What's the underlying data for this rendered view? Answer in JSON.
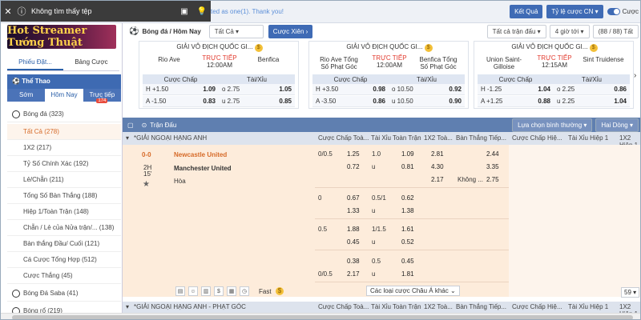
{
  "toast": {
    "title": "Không tìm thấy tệp"
  },
  "top": {
    "thanks": "ted as one(1). Thank you!",
    "ket_qua": "Kết Quả",
    "odds_type": "Tỷ lệ cược CN",
    "toggle_label": "Cược"
  },
  "sidebar": {
    "banner": "Hot Streamer Tướng Thuật",
    "tab_bet": "Phiếu Đặt...",
    "tab_table": "Bảng Cược",
    "sports_title": "Thể Thao",
    "tabs": [
      "Sớm",
      "Hôm Nay",
      "Trực tiếp"
    ],
    "live_badge": "174",
    "items": [
      {
        "label": "Bóng đá (323)",
        "sport": true
      },
      {
        "label": "Tất Cả (278)",
        "selected": true
      },
      {
        "label": "1X2 (217)"
      },
      {
        "label": "Tỷ Số Chính Xác (192)"
      },
      {
        "label": "Lẻ/Chẵn (211)"
      },
      {
        "label": "Tổng Số Bàn Thắng (188)"
      },
      {
        "label": "Hiệp 1/Toàn Trận (148)"
      },
      {
        "label": "Chẵn / Lẻ của Nửa trận/...   (138)"
      },
      {
        "label": "Bàn thắng Đầu/ Cuối (121)"
      },
      {
        "label": "Cá Cược Tổng Hợp (512)"
      },
      {
        "label": "Cược Thắng (45)"
      },
      {
        "label": "Bóng Đá Saba (41)",
        "sport": true
      },
      {
        "label": "Bóng rổ (219)",
        "sport": true
      }
    ]
  },
  "header": {
    "breadcrumb": "Bóng đá / Hôm Nay",
    "filter": "Tất Cả",
    "xien": "Cược Xiên",
    "all_leagues": "Tất cả trận đấu",
    "hours": "4 giờ tới",
    "count": "(88 / 88) Tất"
  },
  "cards": [
    {
      "league": "GIẢI VÔ ĐỊCH QUỐC GI...",
      "home": "Rio Ave",
      "away": "Benfica",
      "live": "TRỰC TIẾP",
      "time": "12:00AM",
      "h_hcap": "+1.50",
      "h_odds": "1.09",
      "h_ou": "o 2.75",
      "h_ou_odds": "1.05",
      "a_hcap": "-1.50",
      "a_odds": "0.83",
      "a_ou": "u 2.75",
      "a_ou_odds": "0.85"
    },
    {
      "league": "GIẢI VÔ ĐỊCH QUỐC GI...",
      "home": "Rio Ave Tổng Số Phạt Góc",
      "away": "Benfica Tổng Số Phạt Góc",
      "live": "TRỰC TIẾP",
      "time": "12:00AM",
      "h_hcap": "+3.50",
      "h_odds": "0.98",
      "h_ou": "o 10.50",
      "h_ou_odds": "0.92",
      "a_hcap": "-3.50",
      "a_odds": "0.86",
      "a_ou": "u 10.50",
      "a_ou_odds": "0.90"
    },
    {
      "league": "GIẢI VÔ ĐỊCH QUỐC GI...",
      "home": "Union Saint-Gilloise",
      "away": "Sint Truidense",
      "live": "TRỰC TIẾP",
      "time": "12:15AM",
      "h_hcap": "-1.25",
      "h_odds": "1.04",
      "h_ou": "o 2.25",
      "h_ou_odds": "0.86",
      "a_hcap": "+1.25",
      "a_odds": "0.88",
      "a_ou": "u 2.25",
      "a_ou_odds": "1.04"
    }
  ],
  "card_labels": {
    "hcap": "Cược Chấp",
    "ou": "Tài/Xỉu",
    "h": "H",
    "a": "A"
  },
  "table": {
    "title": "Trận Đấu",
    "sort": "Lựa chọn bình thường",
    "lines": "Hai Dòng",
    "league": "*GIẢI NGOẠI HẠNG ANH",
    "cols": [
      "Cược Chấp Toà...",
      "Tài Xỉu Toàn Trận",
      "1X2 Toà...",
      "Bàn Thắng Tiếp...",
      "Cược Chấp Hiệ...",
      "Tài Xỉu Hiệp 1",
      "1X2 Hiệp 1"
    ],
    "score": "0-0",
    "period": "2H",
    "minute": "15'",
    "home": "Newcastle United",
    "away": "Manchester United",
    "draw": "Hòa",
    "rows": [
      {
        "hc": "0/0.5",
        "hc1": "1.25",
        "hc2": "0.72",
        "ou": "1.0",
        "ou1": "1.09",
        "ou_u": "u",
        "ou2": "0.81",
        "x1": "2.81",
        "x2": "4.30",
        "x3": "2.17",
        "nx1": "2.44",
        "nx2": "3.35",
        "nx_label": "Không ...",
        "nx3": "2.75"
      },
      {
        "hc": "0",
        "hc1": "0.67",
        "hc2": "1.33",
        "ou": "0.5/1",
        "ou1": "0.62",
        "ou_u": "u",
        "ou2": "1.38"
      },
      {
        "hc": "0.5",
        "hc1": "1.88",
        "hc2": "0.45",
        "ou": "1/1.5",
        "ou1": "1.61",
        "ou_u": "u",
        "ou2": "0.52"
      },
      {
        "hc": "",
        "hc1": "0.38",
        "hc0": "0/0.5",
        "hc2": "2.17",
        "ou": "0.5",
        "ou1": "0.45",
        "ou_u": "u",
        "ou2": "1.81"
      }
    ],
    "fast": "Fast",
    "more": "Các loại cược Châu Á khác",
    "page": "59",
    "league2": "*GIẢI NGOẠI HẠNG ANH - PHẠT GÓC",
    "cols2": [
      "Cược Chấp Toà...",
      "Tài Xỉu Toàn Trận",
      "1X2 Toà...",
      "Bàn Thắng Tiếp...",
      "Cược Chấp Hiệ...",
      "Tài Xỉu Hiệp 1",
      "1X2 Hiệp 1"
    ]
  }
}
